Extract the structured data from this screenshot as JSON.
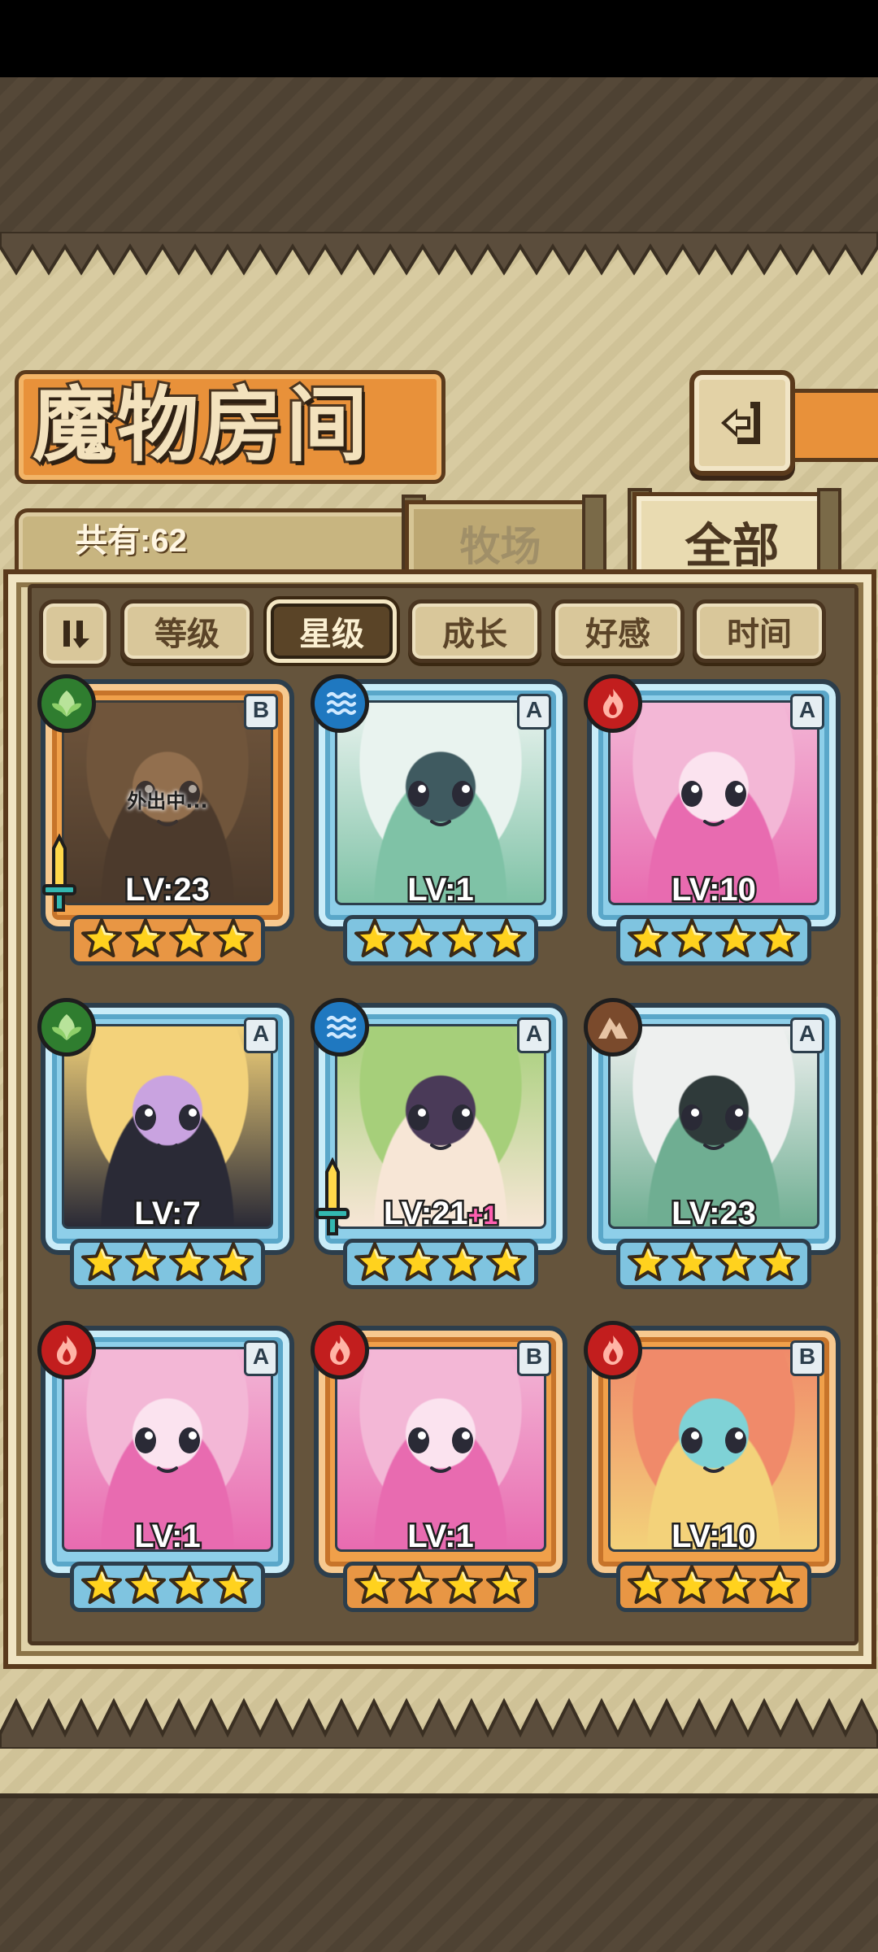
{
  "header": {
    "title": "魔物房间",
    "back_icon": "return-arrow-icon"
  },
  "tabs": {
    "count_label": "共有:62",
    "ranch": "牧场",
    "all": "全部",
    "active": "all"
  },
  "sort": {
    "toggle_icon": "sort-order-icon",
    "options": [
      "等级",
      "星级",
      "成长",
      "好感",
      "时间"
    ],
    "active": "星级"
  },
  "monsters": [
    {
      "rank": "B",
      "element": "nature",
      "level": "LV:23",
      "plus": "",
      "stars": 4,
      "status": "外出中...",
      "weapon": true,
      "palette": [
        "#8a6a4c",
        "#4a3a30",
        "#c99a6e"
      ]
    },
    {
      "rank": "A",
      "element": "water",
      "level": "LV:1",
      "plus": "",
      "stars": 4,
      "status": "",
      "weapon": false,
      "palette": [
        "#e9f3ef",
        "#7fc2a6",
        "#3f5a60"
      ]
    },
    {
      "rank": "A",
      "element": "fire",
      "level": "LV:10",
      "plus": "",
      "stars": 4,
      "status": "",
      "weapon": false,
      "palette": [
        "#f3b7d6",
        "#e86bb0",
        "#fbe3ef"
      ]
    },
    {
      "rank": "A",
      "element": "nature",
      "level": "LV:7",
      "plus": "",
      "stars": 4,
      "status": "",
      "weapon": false,
      "palette": [
        "#f3d27a",
        "#2a2a36",
        "#c9a3e0"
      ]
    },
    {
      "rank": "A",
      "element": "water",
      "level": "LV:21",
      "plus": "+1",
      "stars": 4,
      "status": "",
      "weapon": true,
      "palette": [
        "#a6cf7a",
        "#f7e6d6",
        "#4a3a58"
      ]
    },
    {
      "rank": "A",
      "element": "earth",
      "level": "LV:23",
      "plus": "",
      "stars": 4,
      "status": "",
      "weapon": false,
      "palette": [
        "#eef0ef",
        "#6fae92",
        "#2f3a3a"
      ]
    },
    {
      "rank": "A",
      "element": "fire",
      "level": "LV:1",
      "plus": "",
      "stars": 4,
      "status": "",
      "weapon": false,
      "palette": [
        "#f3b7d6",
        "#e86bb0",
        "#fbe3ef"
      ]
    },
    {
      "rank": "B",
      "element": "fire",
      "level": "LV:1",
      "plus": "",
      "stars": 4,
      "status": "",
      "weapon": false,
      "palette": [
        "#f3b7d6",
        "#e86bb0",
        "#fbe3ef"
      ]
    },
    {
      "rank": "B",
      "element": "fire",
      "level": "LV:10",
      "plus": "",
      "stars": 4,
      "status": "",
      "weapon": false,
      "palette": [
        "#f08a6a",
        "#f3d27a",
        "#7fd2d6"
      ]
    }
  ]
}
